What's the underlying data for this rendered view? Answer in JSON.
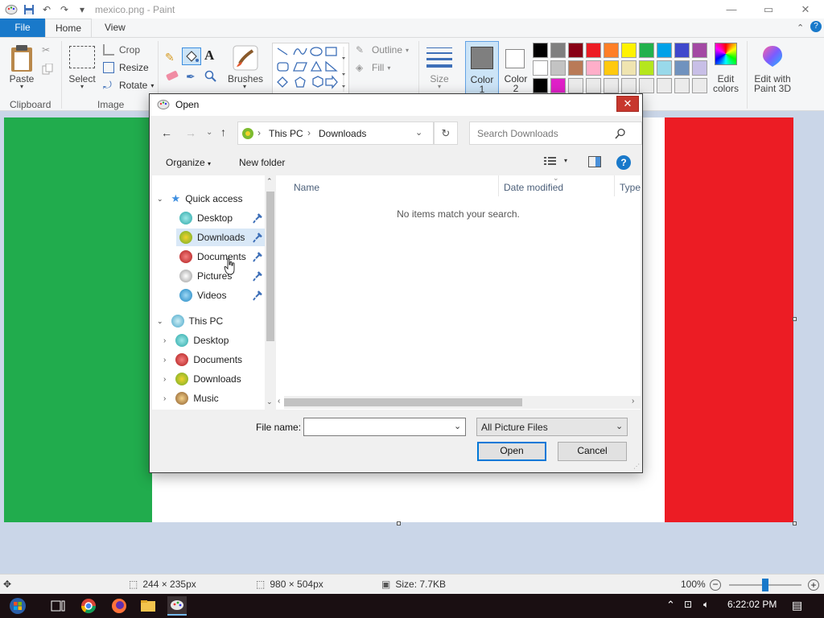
{
  "window": {
    "title": "mexico.png - Paint"
  },
  "tabs": {
    "file": "File",
    "home": "Home",
    "view": "View"
  },
  "ribbon": {
    "paste": "Paste",
    "select": "Select",
    "crop": "Crop",
    "resize": "Resize",
    "rotate": "Rotate",
    "brushes": "Brushes",
    "outline": "Outline",
    "fill": "Fill",
    "size": "Size",
    "color1": "Color\n1",
    "color1_a": "Color",
    "color1_b": "1",
    "color2_a": "Color",
    "color2_b": "2",
    "edit_colors_a": "Edit",
    "edit_colors_b": "colors",
    "paint3d_a": "Edit with",
    "paint3d_b": "Paint 3D",
    "groups": {
      "clipboard": "Clipboard",
      "image": "Image"
    },
    "palette_row1": [
      "#000000",
      "#7f7f7f",
      "#880015",
      "#ed1c24",
      "#ff7f27",
      "#fff200",
      "#22b14c",
      "#00a2e8",
      "#3f48cc",
      "#a349a4"
    ],
    "palette_row2": [
      "#ffffff",
      "#c3c3c3",
      "#b97a57",
      "#ffaec9",
      "#ffc90e",
      "#efe4b0",
      "#b5e61d",
      "#99d9ea",
      "#7092be",
      "#c8bfe7"
    ],
    "palette_row3": [
      "#000000",
      "#e020c8",
      "#ebebeb",
      "#ebebeb",
      "#ebebeb",
      "#ebebeb",
      "#ebebeb",
      "#ebebeb",
      "#ebebeb",
      "#ebebeb"
    ]
  },
  "status": {
    "cursor_pos": "244 × 235px",
    "selection_size": "980 × 504px",
    "file_size": "Size: 7.7KB",
    "zoom": "100%"
  },
  "taskbar": {
    "time": "6:22:02 PM"
  },
  "dialog": {
    "title": "Open",
    "breadcrumb": [
      "This PC",
      "Downloads"
    ],
    "search_placeholder": "Search Downloads",
    "organize": "Organize",
    "new_folder": "New folder",
    "nav": {
      "quick_access": "Quick access",
      "quick_items": [
        "Desktop",
        "Downloads",
        "Documents",
        "Pictures",
        "Videos"
      ],
      "this_pc": "This PC",
      "pc_items": [
        "Desktop",
        "Documents",
        "Downloads",
        "Music"
      ]
    },
    "columns": {
      "name": "Name",
      "date": "Date modified",
      "type": "Type"
    },
    "empty_message": "No items match your search.",
    "file_name_label": "File name:",
    "file_name_value": "",
    "filter": "All Picture Files",
    "open": "Open",
    "cancel": "Cancel"
  }
}
